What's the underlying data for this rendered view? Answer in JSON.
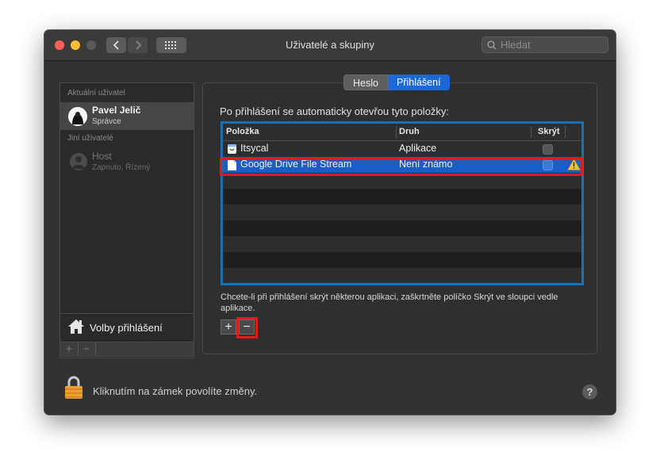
{
  "window": {
    "title": "Uživatelé a skupiny"
  },
  "search": {
    "placeholder": "Hledat"
  },
  "sidebar": {
    "current_label": "Aktuální uživatel",
    "current_user": {
      "name": "Pavel Jelič",
      "role": "Správce"
    },
    "other_label": "Jiní uživatelé",
    "other_user": {
      "name": "Host",
      "role": "Zapnuto, Řízený"
    },
    "login_options": "Volby přihlášení",
    "add": "+",
    "remove": "−"
  },
  "tabs": [
    {
      "label": "Heslo",
      "active": false
    },
    {
      "label": "Přihlášení",
      "active": true
    }
  ],
  "intro": "Po přihlášení se automaticky otevřou tyto položky:",
  "table": {
    "headers": {
      "item": "Položka",
      "kind": "Druh",
      "hide": "Skrýt"
    },
    "rows": [
      {
        "item": "Itsycal",
        "kind": "Aplikace",
        "hidden": false,
        "selected": false
      },
      {
        "item": "Google Drive File Stream",
        "kind": "Není známo",
        "hidden": false,
        "selected": true,
        "warning": true
      }
    ]
  },
  "hint": "Chcete-li při přihlášení skrýt některou aplikaci, zaškrtněte políčko Skrýt ve sloupci vedle aplikace.",
  "buttons": {
    "add": "+",
    "remove": "−"
  },
  "lock_text": "Kliknutím na zámek povolíte změny.",
  "help": "?",
  "colors": {
    "accent": "#1c69d4",
    "highlight": "#e41a1a",
    "table_border": "#1b6fb3"
  }
}
